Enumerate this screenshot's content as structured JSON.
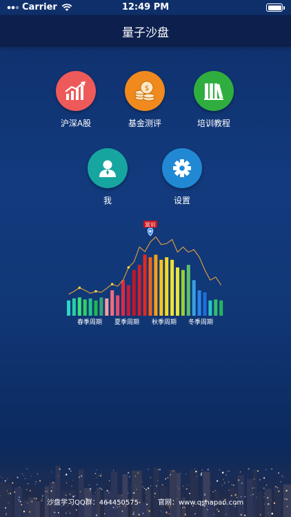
{
  "status_bar": {
    "carrier": "Carrier",
    "time": "12:49 PM"
  },
  "nav": {
    "title": "量子沙盘"
  },
  "menu": [
    {
      "label": "沪深A股",
      "icon": "rising-chart-icon",
      "color": "#ee5a5a"
    },
    {
      "label": "基金测评",
      "icon": "coins-icon",
      "color": "#f08a1e"
    },
    {
      "label": "培训教程",
      "icon": "books-icon",
      "color": "#2fae3f"
    },
    {
      "label": "我",
      "icon": "user-icon",
      "color": "#17a5a0"
    },
    {
      "label": "设置",
      "icon": "gear-icon",
      "color": "#2189d4"
    }
  ],
  "chart_data": {
    "type": "bar",
    "marker_label": "當前",
    "season_labels": [
      "春季周期",
      "夏季周期",
      "秋季周期",
      "冬季周期"
    ],
    "values": [
      3,
      3.4,
      3.6,
      3.2,
      3.4,
      3,
      3.6,
      3.4,
      5,
      4,
      7,
      6,
      9,
      10,
      12,
      11.5,
      12,
      11,
      11.5,
      11,
      9.5,
      9,
      10,
      7,
      5,
      4.6,
      3,
      3.2,
      3
    ],
    "colors": [
      "#2bd6c7",
      "#27cfa8",
      "#3ae27a",
      "#2fcf62",
      "#22c48a",
      "#1fba4f",
      "#3aa17b",
      "#f0a0a0",
      "#f07080",
      "#e04d70",
      "#e02a3f",
      "#c71c3a",
      "#c21626",
      "#d31d2b",
      "#e4281f",
      "#f06516",
      "#f2a01c",
      "#f7c31f",
      "#f5d923",
      "#f1e233",
      "#e8e43d",
      "#9bd02e",
      "#5ec06b",
      "#3a9fe0",
      "#2c85e8",
      "#1e6fda",
      "#2ac2c2",
      "#31bf6f",
      "#27b35e"
    ],
    "line": [
      4.2,
      4.8,
      5.5,
      5,
      4.4,
      4.8,
      4.6,
      5.4,
      6.2,
      5.8,
      7,
      9.5,
      10.6,
      13.5,
      12.6,
      14.5,
      15.5,
      14,
      14.2,
      15,
      12.5,
      13.5,
      12.5,
      13,
      11.5,
      9,
      7,
      7.6,
      6
    ]
  },
  "footer": {
    "qq": "沙盘学习QQ群：464450575",
    "website": "官网：www.qshapan.com"
  }
}
